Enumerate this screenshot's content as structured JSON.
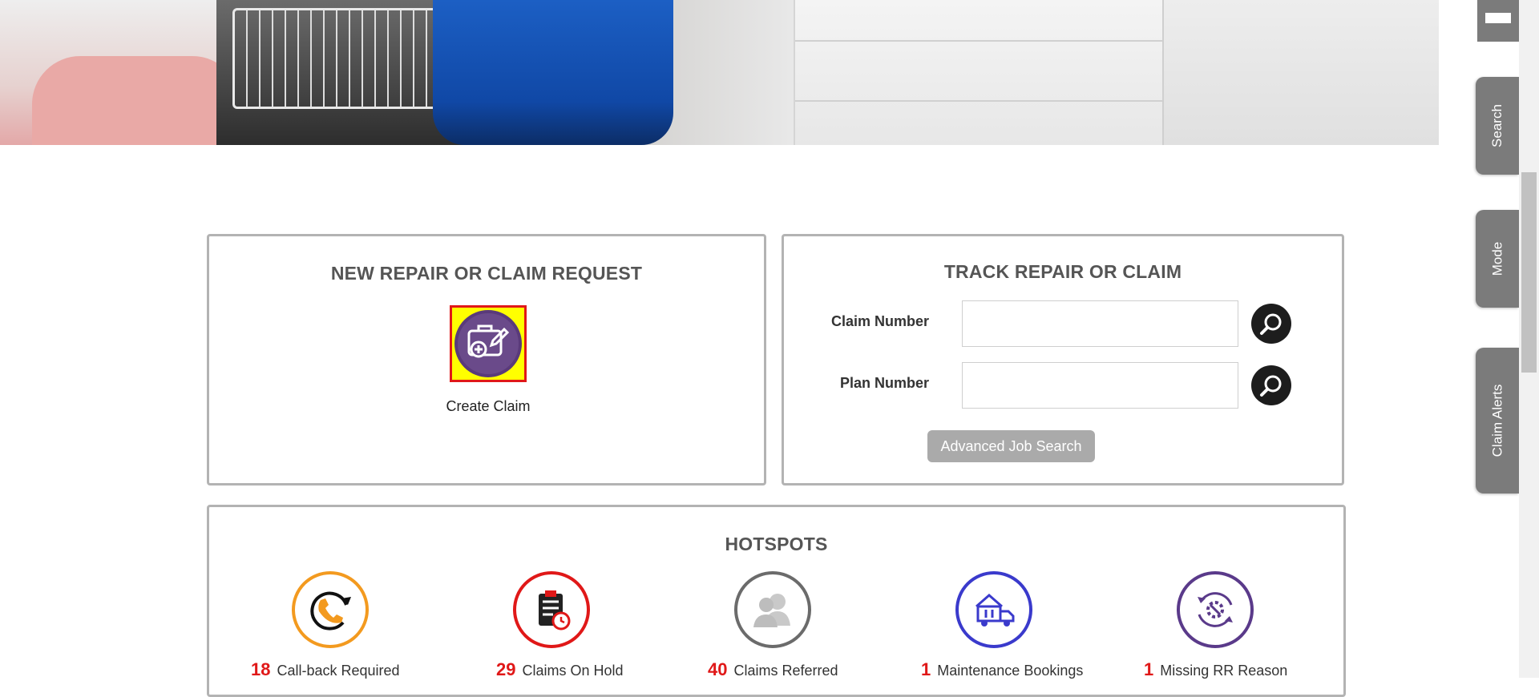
{
  "new_claim": {
    "title": "NEW REPAIR OR CLAIM REQUEST",
    "create_label": "Create Claim",
    "icon": "briefcase-edit-icon"
  },
  "track": {
    "title": "TRACK REPAIR OR CLAIM",
    "claim_label": "Claim Number",
    "claim_value": "",
    "plan_label": "Plan Number",
    "plan_value": "",
    "advanced_label": "Advanced Job Search"
  },
  "sidebar_tabs": {
    "search": "Search",
    "mode": "Mode",
    "alerts": "Claim Alerts"
  },
  "hotspots": {
    "title": "HOTSPOTS",
    "items": [
      {
        "count": "18",
        "label": "Call-back Required",
        "icon": "phone-callback-icon",
        "color": "#f39a1f"
      },
      {
        "count": "29",
        "label": "Claims On Hold",
        "icon": "clipboard-timer-icon",
        "color": "#e01818"
      },
      {
        "count": "40",
        "label": "Claims Referred",
        "icon": "users-icon",
        "color": "#6b6b6b"
      },
      {
        "count": "1",
        "label": "Maintenance Bookings",
        "icon": "van-tools-icon",
        "color": "#3a3acc"
      },
      {
        "count": "1",
        "label": "Missing RR Reason",
        "icon": "gear-refresh-icon",
        "color": "#5a3a8a"
      }
    ]
  },
  "colors": {
    "accent_red": "#e01818",
    "highlight_yellow": "#ffff00",
    "tab_grey": "#7b7b7b"
  }
}
